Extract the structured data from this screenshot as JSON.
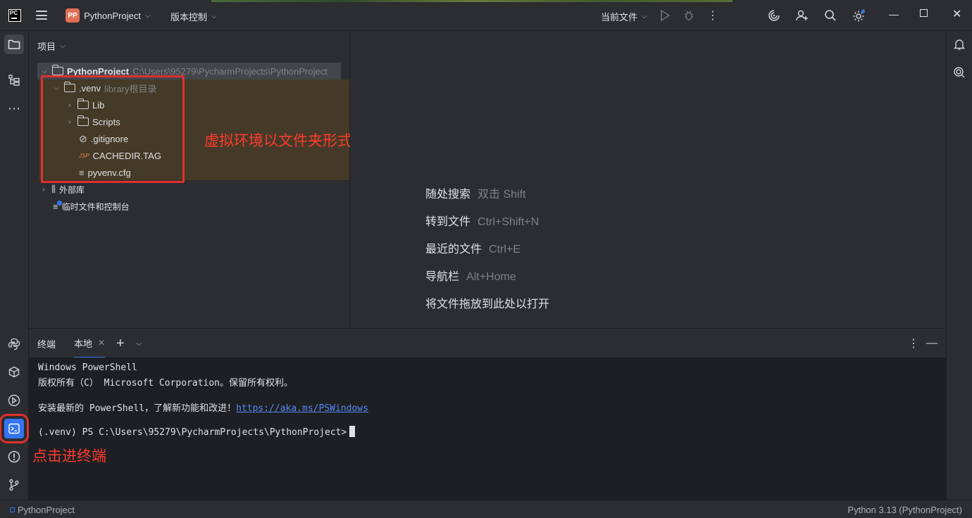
{
  "titlebar": {
    "logo_text": "PC",
    "project_badge": "PP",
    "project_name": "PythonProject",
    "vcs_menu": "版本控制",
    "run_config": "当前文件"
  },
  "project_panel": {
    "header": "项目",
    "tree": [
      {
        "label": "PythonProject",
        "extra": "C:\\Users\\95279\\PycharmProjects\\PythonProject"
      },
      {
        "label": ".venv",
        "extra": "library根目录"
      },
      {
        "label": "Lib"
      },
      {
        "label": "Scripts"
      },
      {
        "label": ".gitignore"
      },
      {
        "label": "CACHEDIR.TAG",
        "icon_text": "JSP"
      },
      {
        "label": "pyvenv.cfg"
      },
      {
        "label": "外部库"
      },
      {
        "label": "临时文件和控制台"
      }
    ]
  },
  "annotations": {
    "venv_note": "虚拟环境以文件夹形式存储",
    "terminal_note": "点击进终端"
  },
  "editor_hints": [
    {
      "label": "随处搜索",
      "key": "双击 Shift"
    },
    {
      "label": "转到文件",
      "key": "Ctrl+Shift+N"
    },
    {
      "label": "最近的文件",
      "key": "Ctrl+E"
    },
    {
      "label": "导航栏",
      "key": "Alt+Home"
    },
    {
      "label": "将文件拖放到此处以打开",
      "key": ""
    }
  ],
  "terminal": {
    "title": "终端",
    "tab_label": "本地",
    "lines": {
      "l1": "Windows PowerShell",
      "l2": "版权所有（C） Microsoft Corporation。保留所有权利。",
      "l3_prefix": "安装最新的 PowerShell，了解新功能和改进！",
      "l3_link": "https://aka.ms/PSWindows",
      "prompt": "(.venv) PS C:\\Users\\95279\\PycharmProjects\\PythonProject>"
    }
  },
  "statusbar": {
    "project": "PythonProject",
    "interpreter": "Python 3.13 (PythonProject)"
  },
  "colors": {
    "accent": "#3574f0",
    "annotation_red": "#e0302f",
    "background": "#2b2d30",
    "terminal_bg": "#1e1f22"
  }
}
